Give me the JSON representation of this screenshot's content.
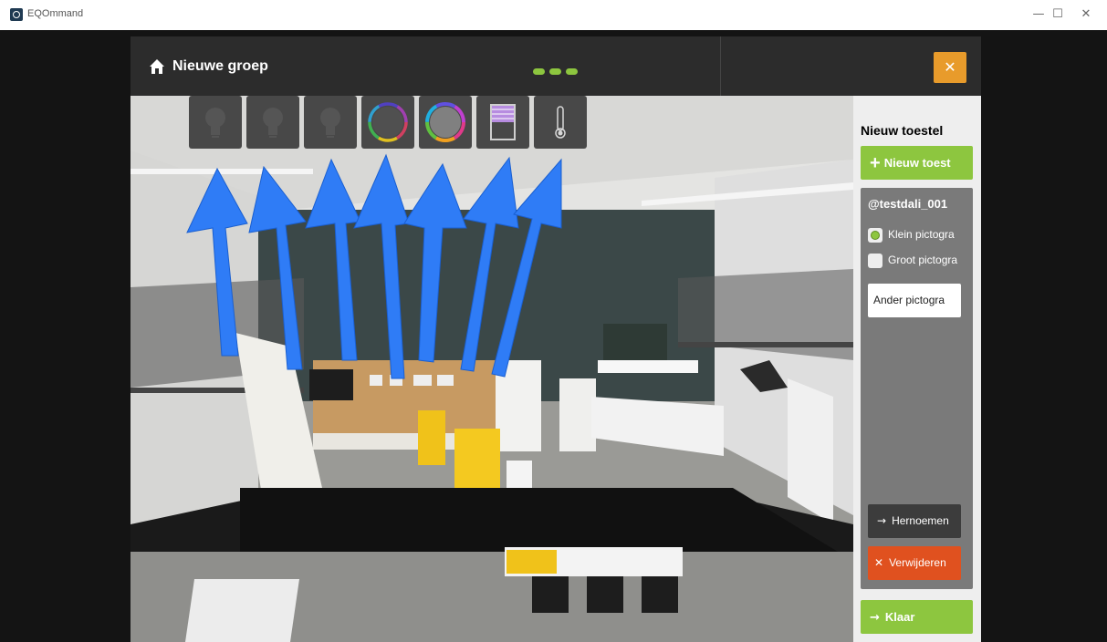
{
  "window": {
    "app_title": "EQOmmand",
    "minimize_glyph": "—",
    "maximize_glyph": "☐",
    "close_glyph": "✕"
  },
  "header": {
    "title": "Nieuwe groep",
    "home_icon": "home-icon",
    "step_count": 3,
    "close_glyph": "✕",
    "accent_color": "#8dc63f",
    "close_color": "#e89b2b"
  },
  "device_icons": [
    {
      "name": "bulb-icon-1",
      "type": "bulb"
    },
    {
      "name": "bulb-icon-2",
      "type": "bulb"
    },
    {
      "name": "bulb-icon-3",
      "type": "bulb"
    },
    {
      "name": "color-ring-icon-1",
      "type": "color-ring"
    },
    {
      "name": "color-ring-icon-2",
      "type": "color-ring"
    },
    {
      "name": "shutter-icon",
      "type": "shutter"
    },
    {
      "name": "thermometer-icon",
      "type": "thermometer"
    }
  ],
  "sidebar": {
    "heading": "Nieuw toestel",
    "new_device_button": "Nieuw toest",
    "device": {
      "name": "@testdali_001",
      "option_small": "Klein pictogra",
      "option_large": "Groot pictogra",
      "selected_option": "small",
      "other_icon_button": "Ander pictogra",
      "rename_button": "Hernoemen",
      "delete_button": "Verwijderen"
    },
    "done_button": "Klaar"
  },
  "colors": {
    "green": "#8dc63f",
    "orange": "#e89b2b",
    "delete_red": "#e0511f",
    "arrow_blue": "#2f7cf6"
  }
}
